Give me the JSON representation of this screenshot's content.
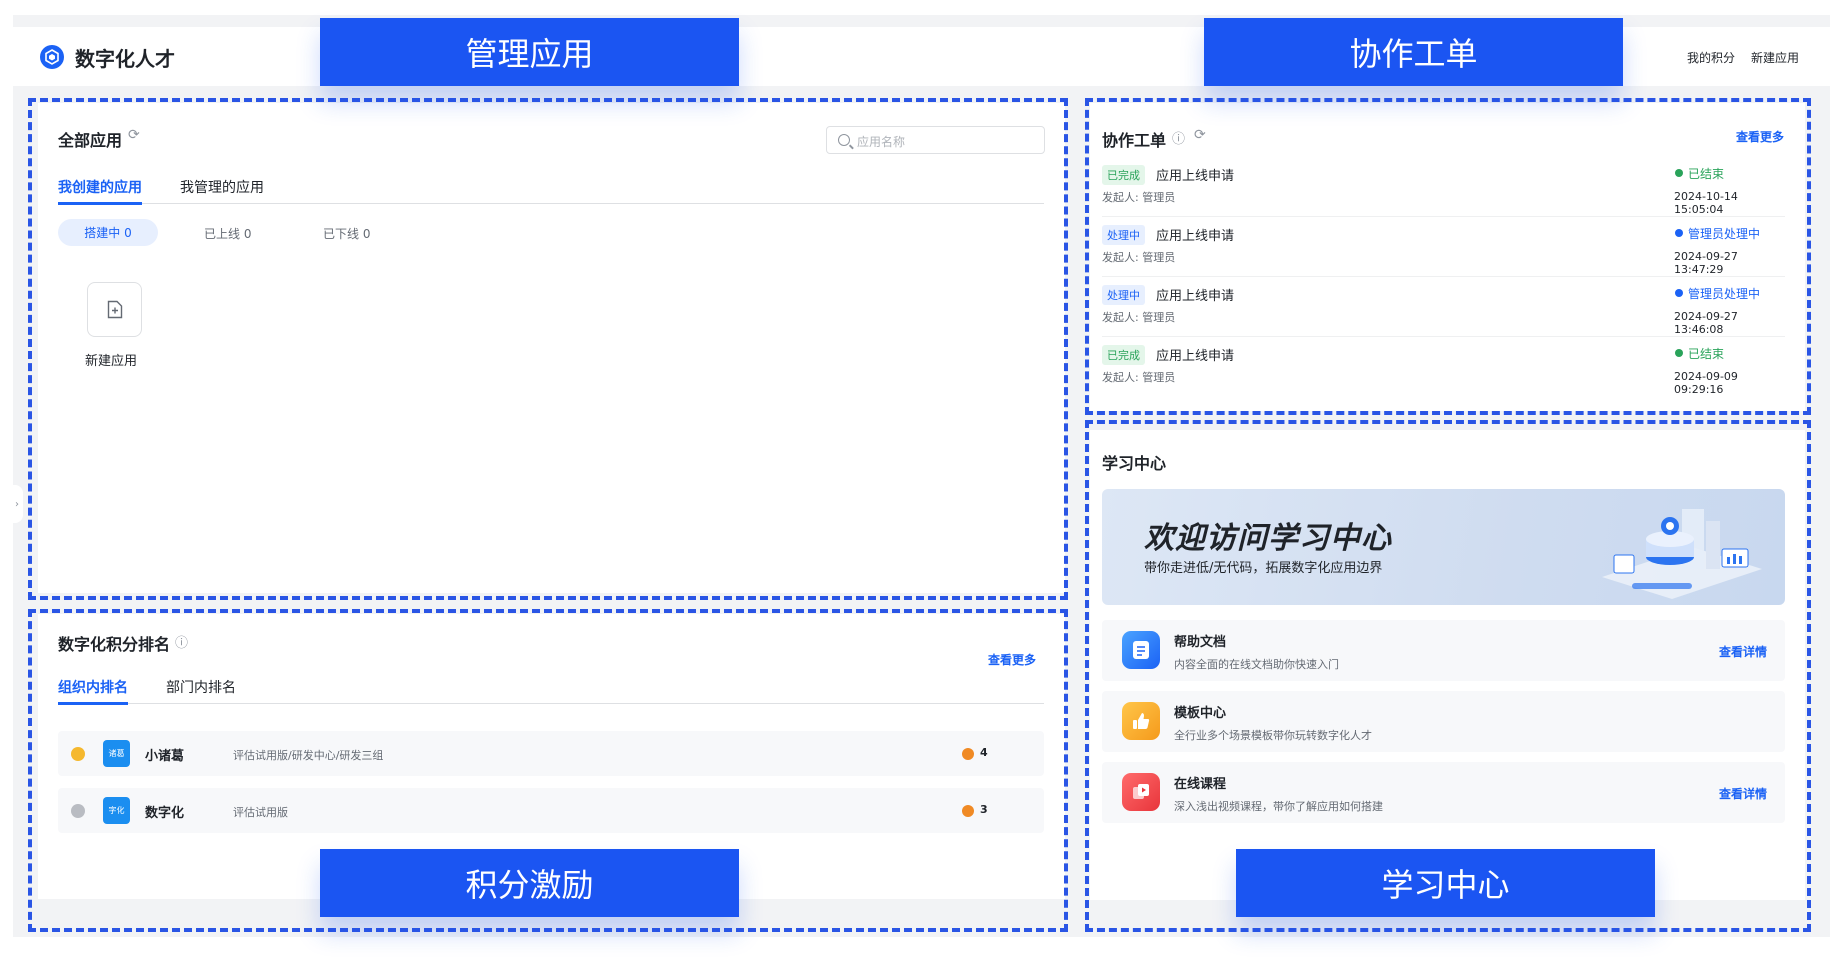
{
  "brand": {
    "name": "数字化人才"
  },
  "top_links": [
    "我的积分",
    "新建应用"
  ],
  "overlay_labels": {
    "manage": "管理应用",
    "ticket": "协作工单",
    "points": "积分激励",
    "learn": "学习中心"
  },
  "apps": {
    "title": "全部应用",
    "search_placeholder": "应用名称",
    "tabs": [
      "我创建的应用",
      "我管理的应用"
    ],
    "filters": [
      "搭建中 0",
      "已上线 0",
      "已下线 0"
    ],
    "new_app_label": "新建应用"
  },
  "ranking": {
    "title": "数字化积分排名",
    "more": "查看更多",
    "tabs": [
      "组织内排名",
      "部门内排名"
    ],
    "rows": [
      {
        "avatar": "诸葛",
        "name": "小诸葛",
        "dept": "评估试用版/研发中心/研发三组",
        "points": "4"
      },
      {
        "avatar": "字化",
        "name": "数字化",
        "dept": "评估试用版",
        "points": "3"
      }
    ]
  },
  "tickets": {
    "title": "协作工单",
    "more": "查看更多",
    "items": [
      {
        "tag": "已完成",
        "tag_type": "done",
        "title": "应用上线申请",
        "initiator": "发起人: 管理员",
        "status": "已结束",
        "status_color": "#29a35a",
        "time": "2024-10-14 15:05:04"
      },
      {
        "tag": "处理中",
        "tag_type": "proc",
        "title": "应用上线申请",
        "initiator": "发起人: 管理员",
        "status": "管理员处理中",
        "status_color": "#1b62f5",
        "time": "2024-09-27 13:47:29"
      },
      {
        "tag": "处理中",
        "tag_type": "proc",
        "title": "应用上线申请",
        "initiator": "发起人: 管理员",
        "status": "管理员处理中",
        "status_color": "#1b62f5",
        "time": "2024-09-27 13:46:08"
      },
      {
        "tag": "已完成",
        "tag_type": "done",
        "title": "应用上线申请",
        "initiator": "发起人: 管理员",
        "status": "已结束",
        "status_color": "#29a35a",
        "time": "2024-09-09 09:29:16"
      }
    ]
  },
  "learning": {
    "title": "学习中心",
    "banner_heading": "欢迎访问学习中心",
    "banner_sub": "带你走进低/无代码，拓展数字化应用边界",
    "items": [
      {
        "icon": "doc-icon",
        "title": "帮助文档",
        "desc": "内容全面的在线文档助你快速入门",
        "link": "查看详情"
      },
      {
        "icon": "thumbs-up-icon",
        "title": "模板中心",
        "desc": "全行业多个场景模板带你玩转数字化人才",
        "link": ""
      },
      {
        "icon": "course-icon",
        "title": "在线课程",
        "desc": "深入浅出视频课程，带你了解应用如何搭建",
        "link": "查看详情"
      }
    ]
  },
  "colors": {
    "accent": "#1b62f5",
    "overlay": "#1b55f2",
    "dash": "#2a55e5",
    "success": "#29a35a"
  }
}
